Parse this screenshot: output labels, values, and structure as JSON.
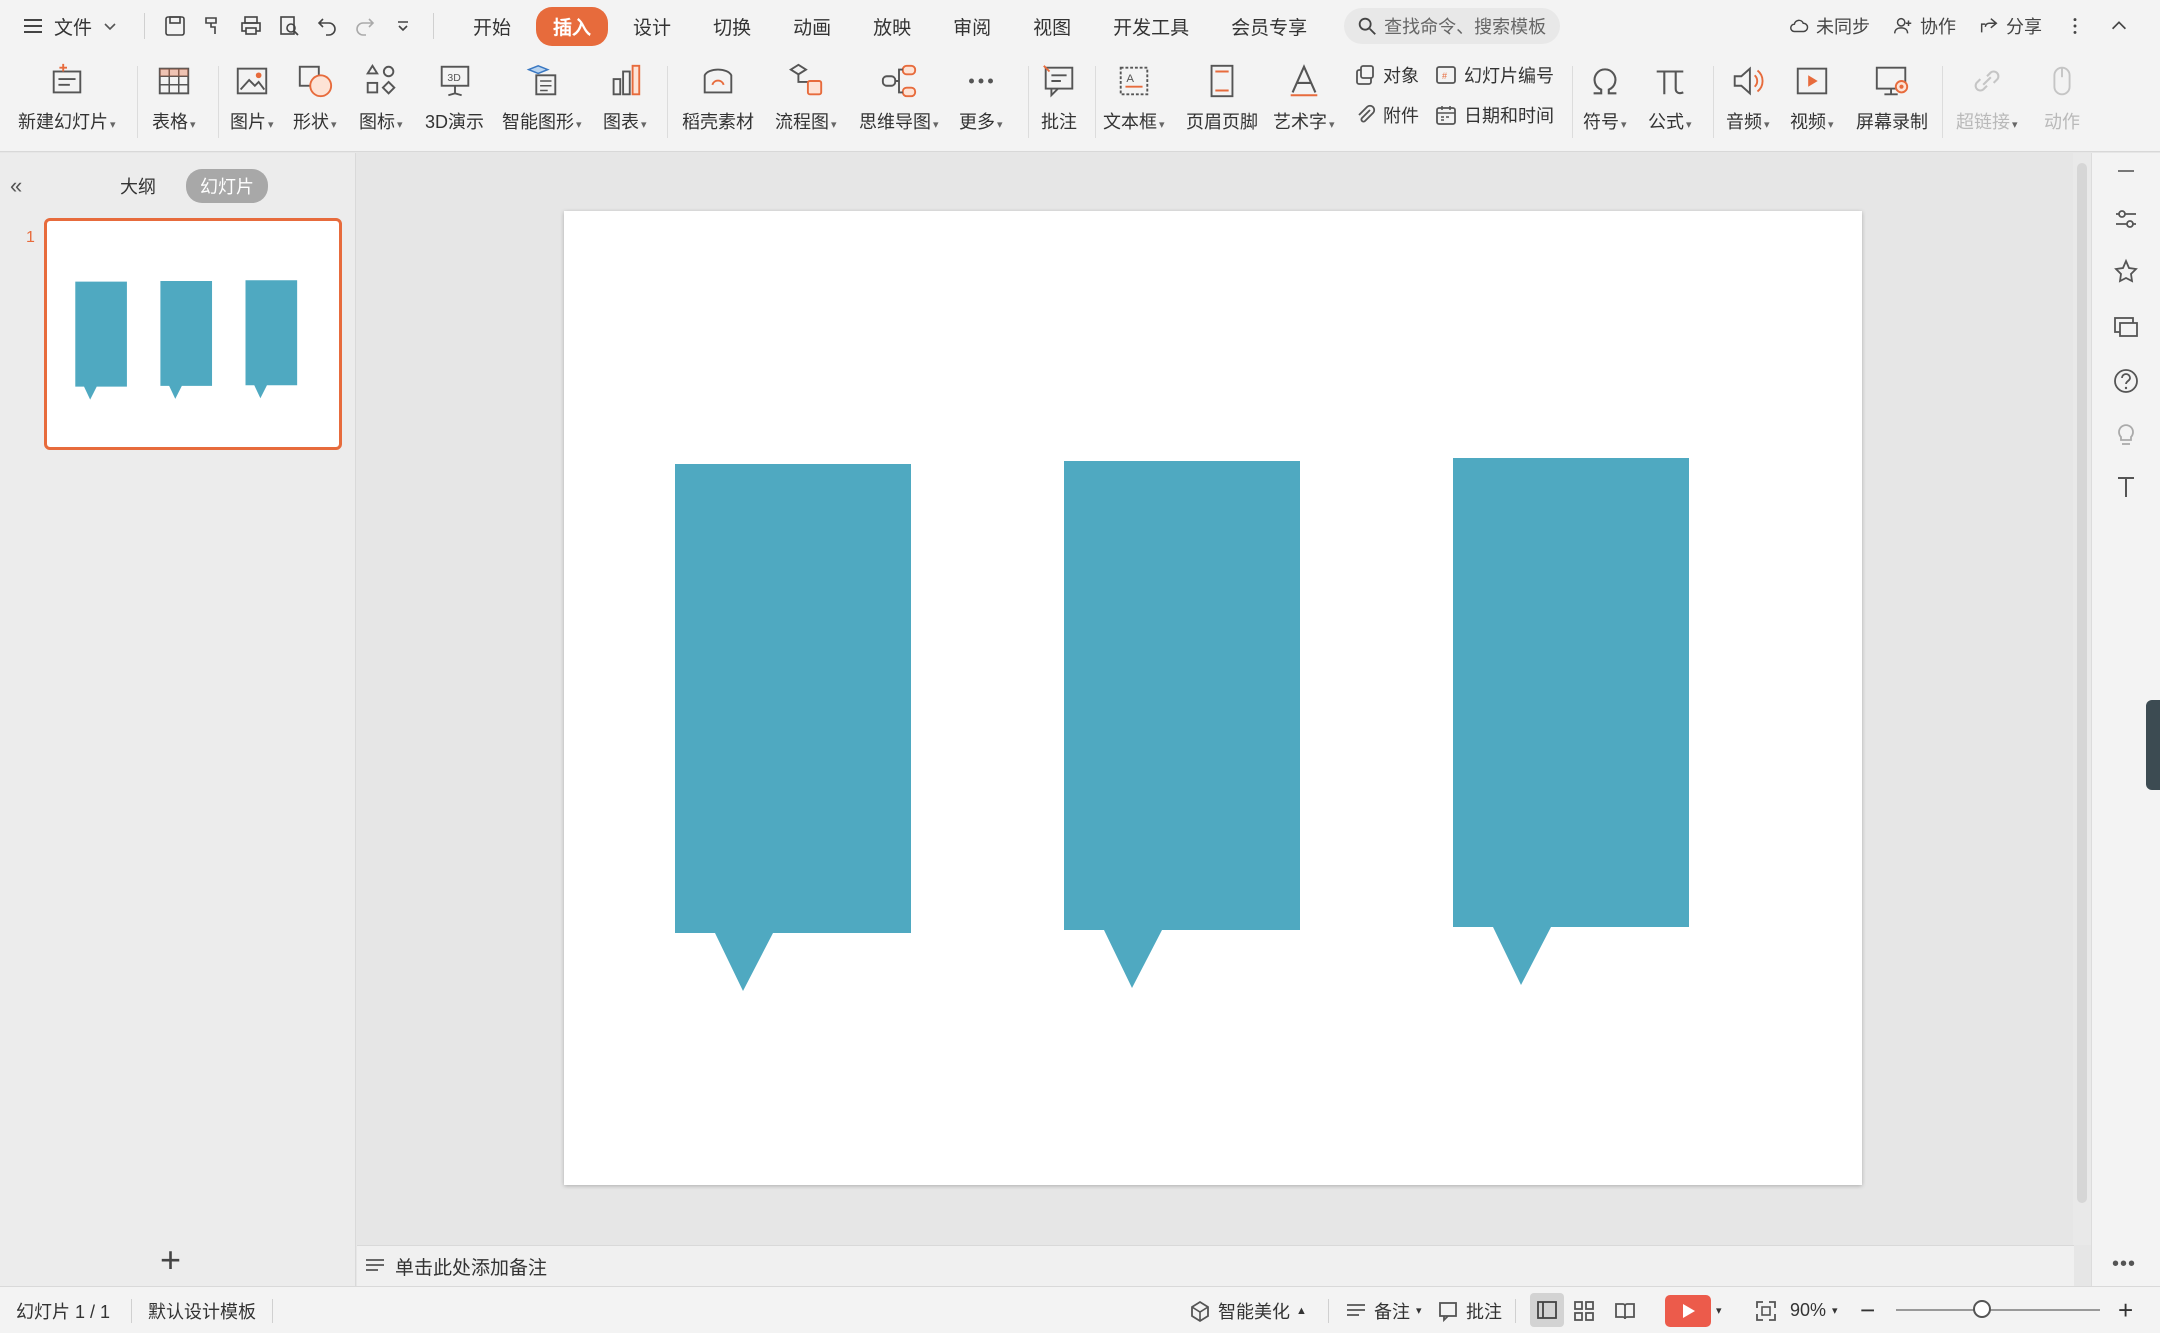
{
  "menubar": {
    "file_label": "文件",
    "tabs": [
      "开始",
      "插入",
      "设计",
      "切换",
      "动画",
      "放映",
      "审阅",
      "视图",
      "开发工具",
      "会员专享"
    ],
    "active_tab": "插入",
    "search_placeholder": "查找命令、搜索模板",
    "sync_label": "未同步",
    "collab_label": "协作",
    "share_label": "分享"
  },
  "ribbon": {
    "new_slide": "新建幻灯片",
    "table": "表格",
    "picture": "图片",
    "shape": "形状",
    "icon": "图标",
    "demo3d": "3D演示",
    "smartart": "智能图形",
    "chart": "图表",
    "material": "稻壳素材",
    "flowchart": "流程图",
    "mindmap": "思维导图",
    "more": "更多",
    "comment": "批注",
    "textbox": "文本框",
    "header_footer": "页眉页脚",
    "wordart": "艺术字",
    "object": "对象",
    "slide_number": "幻灯片编号",
    "attachment": "附件",
    "datetime": "日期和时间",
    "symbol": "符号",
    "formula": "公式",
    "audio": "音频",
    "video": "视频",
    "screen_record": "屏幕录制",
    "hyperlink": "超链接",
    "action": "动作"
  },
  "leftpanel": {
    "tab_outline": "大纲",
    "tab_slides": "幻灯片",
    "slide_number": "1"
  },
  "slide": {
    "background": "#ffffff",
    "shape_color": "#4fa9c1",
    "shape_count": 3
  },
  "notes": {
    "placeholder": "单击此处添加备注"
  },
  "status": {
    "slide_info": "幻灯片 1 / 1",
    "template": "默认设计模板",
    "beautify": "智能美化",
    "notes": "备注",
    "comments": "批注",
    "zoom": "90%"
  },
  "colors": {
    "accent": "#e76b3c",
    "play": "#ec5b4b"
  }
}
